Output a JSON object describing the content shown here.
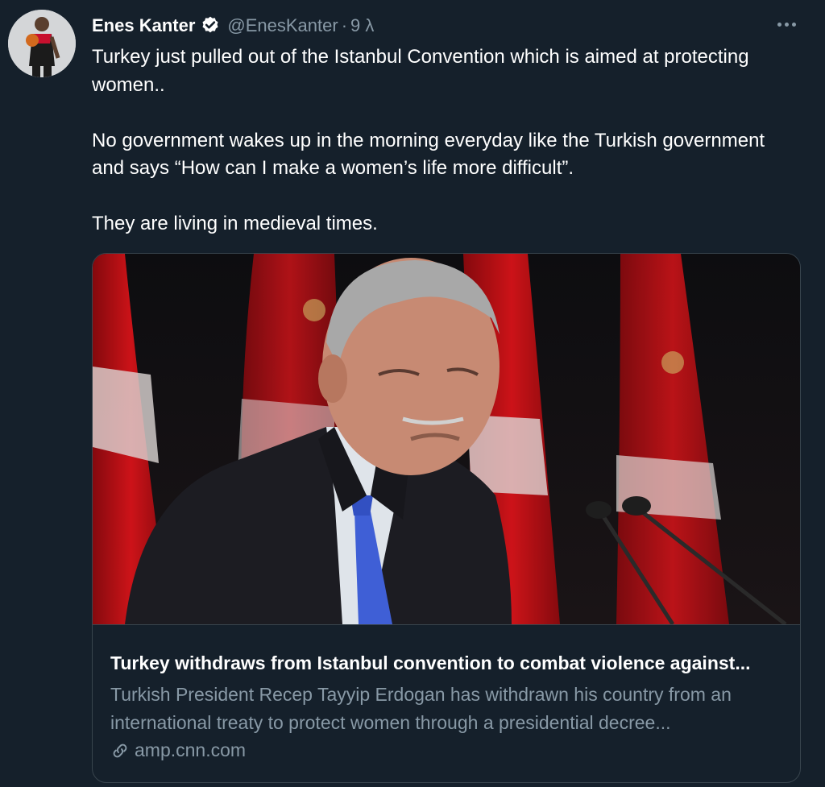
{
  "tweet": {
    "display_name": "Enes Kanter",
    "verified_icon": "verified-badge-icon",
    "handle": "@EnesKanter",
    "separator": "·",
    "timestamp": "9 λ",
    "paragraphs": [
      "Turkey just pulled out of the Istanbul Convention which is aimed at protecting women..",
      "No government wakes up in the morning everyday like the Turkish government and says “How can I make a women’s life more difficult”.",
      "They are living in medieval times."
    ]
  },
  "link_card": {
    "title": "Turkey withdraws from Istanbul convention to combat violence against...",
    "description": "Turkish President Recep Tayyip Erdogan has withdrawn his country from an international treaty to protect women through a presidential decree...",
    "domain": "amp.cnn.com",
    "link_icon": "link-icon"
  },
  "colors": {
    "background": "#15202b",
    "border": "#38444d",
    "secondary_text": "#8899a6",
    "verified_badge": "#ffffff",
    "flag_red": "#d7141a"
  }
}
